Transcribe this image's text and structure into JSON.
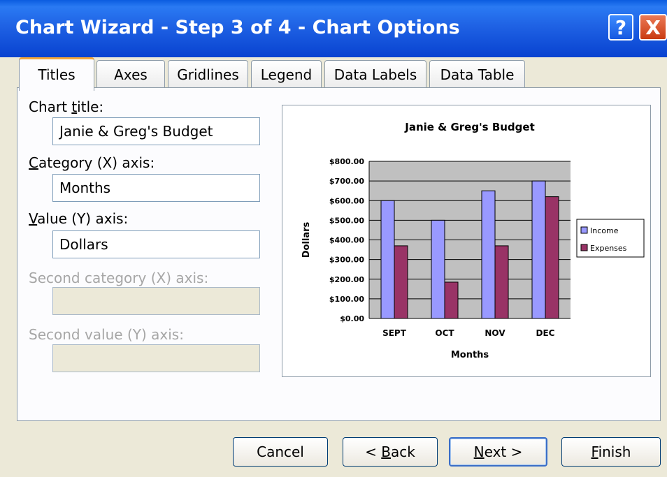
{
  "window": {
    "title": "Chart Wizard - Step 3 of 4 - Chart Options",
    "help_glyph": "?",
    "close_glyph": "X"
  },
  "tabs": [
    {
      "label": "Titles",
      "active": true
    },
    {
      "label": "Axes",
      "active": false
    },
    {
      "label": "Gridlines",
      "active": false
    },
    {
      "label": "Legend",
      "active": false
    },
    {
      "label": "Data Labels",
      "active": false
    },
    {
      "label": "Data Table",
      "active": false
    }
  ],
  "form": {
    "chart_title": {
      "label_pre": "Chart ",
      "label_key": "t",
      "label_post": "itle:",
      "value": "Janie & Greg's Budget"
    },
    "category_axis": {
      "label_key": "C",
      "label_post": "ategory (X) axis:",
      "value": "Months"
    },
    "value_axis": {
      "label_key": "V",
      "label_post": "alue (Y) axis:",
      "value": "Dollars"
    },
    "second_category_axis": {
      "label": "Second category (X) axis:",
      "value": ""
    },
    "second_value_axis": {
      "label": "Second value (Y) axis:",
      "value": ""
    }
  },
  "buttons": {
    "cancel": "Cancel",
    "back_pre": "< ",
    "back_key": "B",
    "back_post": "ack",
    "next_key": "N",
    "next_post": "ext >",
    "finish_key": "F",
    "finish_post": "inish"
  },
  "chart_data": {
    "type": "bar",
    "title": "Janie & Greg's Budget",
    "xlabel": "Months",
    "ylabel": "Dollars",
    "categories": [
      "SEPT",
      "OCT",
      "NOV",
      "DEC"
    ],
    "series": [
      {
        "name": "Income",
        "values": [
          600,
          500,
          650,
          700
        ],
        "color": "#9999ff"
      },
      {
        "name": "Expenses",
        "values": [
          370,
          185,
          370,
          620
        ],
        "color": "#993366"
      }
    ],
    "ylim": [
      0,
      800
    ],
    "yticks": [
      "$0.00",
      "$100.00",
      "$200.00",
      "$300.00",
      "$400.00",
      "$500.00",
      "$600.00",
      "$700.00",
      "$800.00"
    ],
    "plot_background": "#c0c0c0",
    "grid": true,
    "legend_position": "right"
  }
}
